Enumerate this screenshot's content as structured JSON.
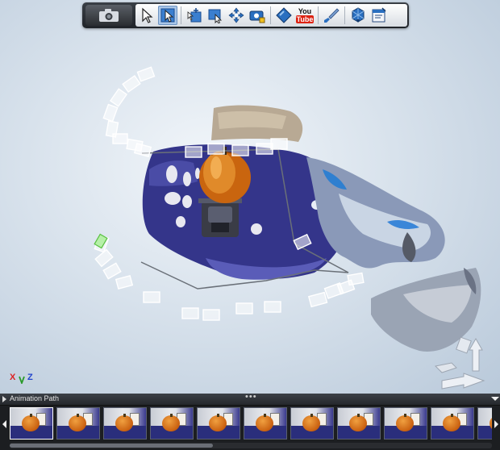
{
  "toolbar": {
    "capture_icon": "camera-icon",
    "tools": [
      {
        "icon": "select-arrow-icon",
        "active": false
      },
      {
        "icon": "select-region-icon",
        "active": true
      },
      {
        "icon": "add-marker-icon",
        "active": false
      },
      {
        "icon": "edit-region-icon",
        "active": false
      },
      {
        "icon": "move-view-icon",
        "active": false
      },
      {
        "icon": "snapshot-camera-icon",
        "active": false
      },
      {
        "icon": "measure-icon",
        "active": false
      },
      {
        "icon": "youtube-icon",
        "active": false
      },
      {
        "icon": "paint-brush-icon",
        "active": false
      },
      {
        "icon": "export-mesh-icon",
        "active": false
      },
      {
        "icon": "document-icon",
        "active": false
      }
    ],
    "youtube": {
      "you": "You",
      "tube": "Tube"
    }
  },
  "viewport": {
    "axis": {
      "x": "X",
      "z": "Z"
    }
  },
  "animation_panel": {
    "title": "Animation Path",
    "grip": "•••",
    "thumbnail_count": 11
  }
}
